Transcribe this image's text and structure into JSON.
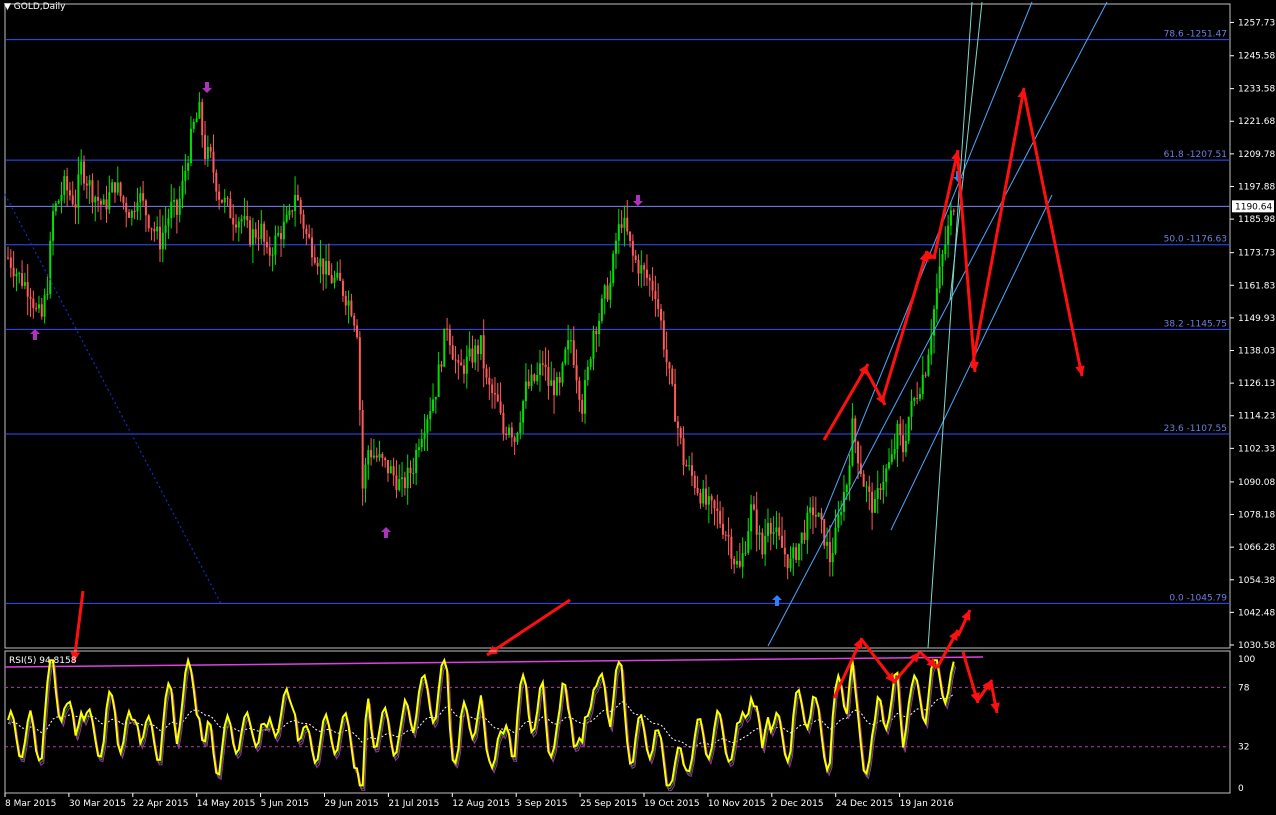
{
  "window": {
    "title": "GOLD,Daily",
    "menu_glyph": "▼"
  },
  "colors": {
    "background": "#000000",
    "bull": "#00e000",
    "bear": "#ff5a5a",
    "fib": "#3050ff",
    "fib_text": "#6f7fe0",
    "arrow": "#ff1010",
    "channel": "#4aa8ff",
    "fan": "#7fd8c8",
    "trend_dotted": "#1030c0",
    "fractal": "#b030c0",
    "fractal_blue": "#2a80ff",
    "rsi": "#ffff00",
    "rsi_avg": "#ffffff",
    "rsi_level": "#b040b0",
    "rsi_top": "#e040e0",
    "axis_text": "#ffffff",
    "price_tag_bg": "#ffffff"
  },
  "chart_data": [
    {
      "type": "candlestick",
      "title": "GOLD,Daily",
      "ylim": [
        1030.58,
        1263
      ],
      "y_ticks": [
        "1257.73",
        "1245.58",
        "1233.58",
        "1221.68",
        "1209.78",
        "1197.88",
        "1185.98",
        "1173.73",
        "1161.83",
        "1149.93",
        "1138.03",
        "1126.13",
        "1114.23",
        "1102.33",
        "1090.08",
        "1078.18",
        "1066.28",
        "1054.38",
        "1042.48",
        "1030.58"
      ],
      "current_price": "1190.64",
      "x_labels": [
        "8 Mar 2015",
        "30 Mar 2015",
        "22 Apr 2015",
        "14 May 2015",
        "5 Jun 2015",
        "29 Jun 2015",
        "21 Jul 2015",
        "12 Aug 2015",
        "3 Sep 2015",
        "25 Sep 2015",
        "19 Oct 2015",
        "10 Nov 2015",
        "2 Dec 2015",
        "24 Dec 2015",
        "19 Jan 2016"
      ],
      "fib_levels": [
        {
          "label": "78.6 -1251.47",
          "value": 1251.47
        },
        {
          "label": "61.8 -1207.51",
          "value": 1207.51
        },
        {
          "label": "50.0 -1176.63",
          "value": 1176.63
        },
        {
          "label": "38.2 -1145.75",
          "value": 1145.75
        },
        {
          "label": "23.6 -1107.55",
          "value": 1107.55
        },
        {
          "label": "0.0 -1045.79",
          "value": 1045.79
        }
      ],
      "horizontal_line": 1190.64,
      "price_path": [
        [
          0,
          1172
        ],
        [
          4,
          1165
        ],
        [
          8,
          1160
        ],
        [
          10,
          1152
        ],
        [
          12,
          1150
        ],
        [
          14,
          1162
        ],
        [
          16,
          1188
        ],
        [
          20,
          1198
        ],
        [
          24,
          1192
        ],
        [
          26,
          1205
        ],
        [
          30,
          1196
        ],
        [
          34,
          1190
        ],
        [
          38,
          1199
        ],
        [
          41,
          1192
        ],
        [
          44,
          1188
        ],
        [
          46,
          1196
        ],
        [
          50,
          1186
        ],
        [
          54,
          1178
        ],
        [
          58,
          1190
        ],
        [
          60,
          1188
        ],
        [
          62,
          1198
        ],
        [
          64,
          1210
        ],
        [
          66,
          1220
        ],
        [
          68,
          1225
        ],
        [
          70,
          1210
        ],
        [
          72,
          1208
        ],
        [
          75,
          1195
        ],
        [
          80,
          1187
        ],
        [
          83,
          1186
        ],
        [
          86,
          1180
        ],
        [
          90,
          1182
        ],
        [
          92,
          1172
        ],
        [
          96,
          1180
        ],
        [
          100,
          1186
        ],
        [
          102,
          1196
        ],
        [
          104,
          1188
        ],
        [
          106,
          1180
        ],
        [
          110,
          1172
        ],
        [
          114,
          1165
        ],
        [
          118,
          1162
        ],
        [
          122,
          1154
        ],
        [
          124,
          1146
        ],
        [
          126,
          1088
        ],
        [
          128,
          1102
        ],
        [
          132,
          1098
        ],
        [
          136,
          1094
        ],
        [
          140,
          1088
        ],
        [
          144,
          1096
        ],
        [
          146,
          1106
        ],
        [
          148,
          1112
        ],
        [
          152,
          1124
        ],
        [
          156,
          1148
        ],
        [
          158,
          1138
        ],
        [
          160,
          1130
        ],
        [
          164,
          1135
        ],
        [
          168,
          1140
        ],
        [
          170,
          1126
        ],
        [
          174,
          1118
        ],
        [
          176,
          1108
        ],
        [
          178,
          1112
        ],
        [
          180,
          1106
        ],
        [
          184,
          1124
        ],
        [
          188,
          1128
        ],
        [
          190,
          1134
        ],
        [
          192,
          1126
        ],
        [
          196,
          1124
        ],
        [
          198,
          1136
        ],
        [
          200,
          1142
        ],
        [
          202,
          1130
        ],
        [
          204,
          1118
        ],
        [
          206,
          1130
        ],
        [
          208,
          1146
        ],
        [
          210,
          1150
        ],
        [
          212,
          1158
        ],
        [
          214,
          1162
        ],
        [
          216,
          1178
        ],
        [
          218,
          1186
        ],
        [
          220,
          1180
        ],
        [
          222,
          1172
        ],
        [
          226,
          1166
        ],
        [
          230,
          1160
        ],
        [
          232,
          1148
        ],
        [
          234,
          1134
        ],
        [
          236,
          1122
        ],
        [
          238,
          1110
        ],
        [
          240,
          1098
        ],
        [
          244,
          1090
        ],
        [
          248,
          1082
        ],
        [
          252,
          1078
        ],
        [
          254,
          1074
        ],
        [
          256,
          1070
        ],
        [
          258,
          1062
        ],
        [
          260,
          1058
        ],
        [
          262,
          1068
        ],
        [
          264,
          1080
        ],
        [
          266,
          1074
        ],
        [
          268,
          1064
        ],
        [
          270,
          1078
        ],
        [
          272,
          1072
        ],
        [
          274,
          1068
        ],
        [
          276,
          1064
        ],
        [
          278,
          1060
        ],
        [
          282,
          1070
        ],
        [
          286,
          1080
        ],
        [
          288,
          1076
        ],
        [
          290,
          1070
        ],
        [
          292,
          1062
        ],
        [
          294,
          1070
        ],
        [
          296,
          1082
        ],
        [
          298,
          1090
        ],
        [
          300,
          1110
        ],
        [
          302,
          1100
        ],
        [
          304,
          1090
        ],
        [
          306,
          1084
        ],
        [
          308,
          1080
        ],
        [
          310,
          1090
        ],
        [
          314,
          1098
        ],
        [
          316,
          1108
        ],
        [
          318,
          1102
        ],
        [
          320,
          1114
        ],
        [
          322,
          1120
        ],
        [
          324,
          1126
        ],
        [
          326,
          1132
        ],
        [
          328,
          1146
        ],
        [
          330,
          1160
        ],
        [
          332,
          1172
        ],
        [
          334,
          1182
        ],
        [
          336,
          1192
        ]
      ],
      "arrows_note": "hand-drawn red zigzag projections"
    },
    {
      "type": "line",
      "title": "RSI(5) 94.8158",
      "ylim": [
        0,
        100
      ],
      "y_ticks": [
        "100",
        "78",
        "32",
        "0"
      ],
      "levels": [
        78,
        32
      ],
      "series": [
        {
          "name": "RSI(5)"
        }
      ]
    }
  ]
}
